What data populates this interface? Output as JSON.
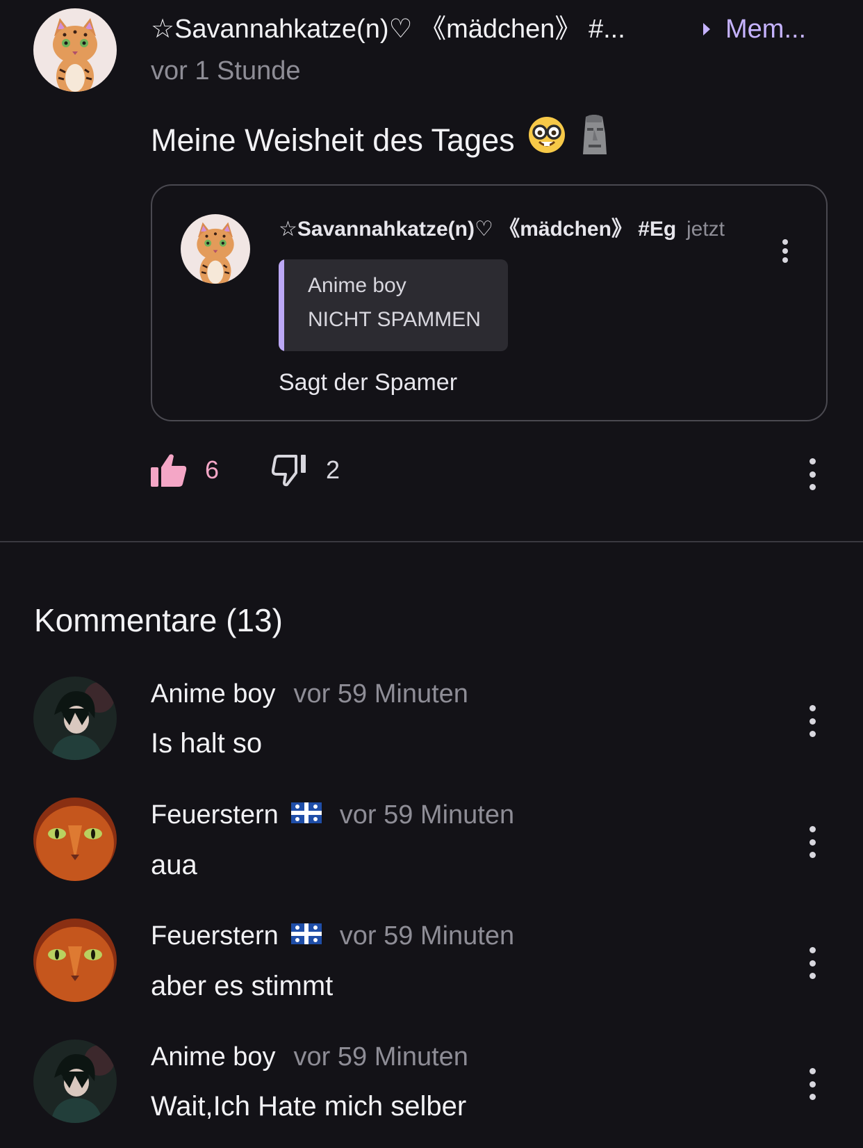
{
  "post": {
    "author": "☆Savannahkatze(n)♡ 《mädchen》 #...",
    "group_label": "Mem...",
    "time": "vor 1 Stunde",
    "body": "Meine Weisheit des Tages",
    "emoji_1": "nerd-face-emoji",
    "emoji_2": "moai-emoji",
    "quote": {
      "author": "☆Savannahkatze(n)♡ 《mädchen》 #Eg",
      "time": "jetzt",
      "reply_to_name": "Anime boy",
      "reply_to_text": "NICHT SPAMMEN",
      "body": "Sagt der Spamer"
    },
    "likes": "6",
    "dislikes": "2",
    "colors": {
      "accent": "#c6b3ff",
      "like": "#f4a6c6",
      "background": "#131217"
    }
  },
  "comments_heading": "Kommentare (13)",
  "comments": [
    {
      "name": "Anime boy",
      "time": "vor 59 Minuten",
      "text": "Is halt so",
      "flag": ""
    },
    {
      "name": "Feuerstern",
      "time": "vor 59 Minuten",
      "text": "aua",
      "flag": "quebec-flag"
    },
    {
      "name": "Feuerstern",
      "time": "vor 59 Minuten",
      "text": "aber es stimmt",
      "flag": "quebec-flag"
    },
    {
      "name": "Anime boy",
      "time": "vor 59 Minuten",
      "text": "Wait,Ich Hate mich selber",
      "flag": ""
    }
  ]
}
